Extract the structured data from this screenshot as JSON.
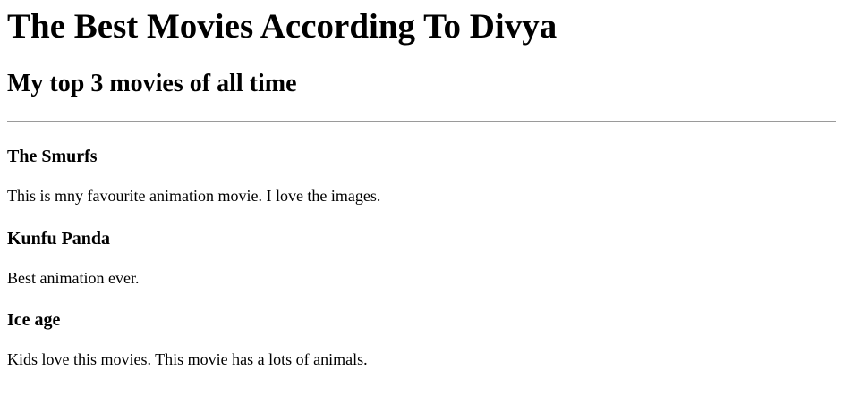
{
  "page": {
    "title": "The Best Movies According To Divya",
    "subtitle": "My top 3 movies of all time"
  },
  "movies": [
    {
      "title": "The Smurfs",
      "description": "This is mny favourite animation movie. I love the images."
    },
    {
      "title": "Kunfu Panda",
      "description": "Best animation ever."
    },
    {
      "title": "Ice age",
      "description": "Kids love this movies. This movie has a lots of animals."
    }
  ]
}
